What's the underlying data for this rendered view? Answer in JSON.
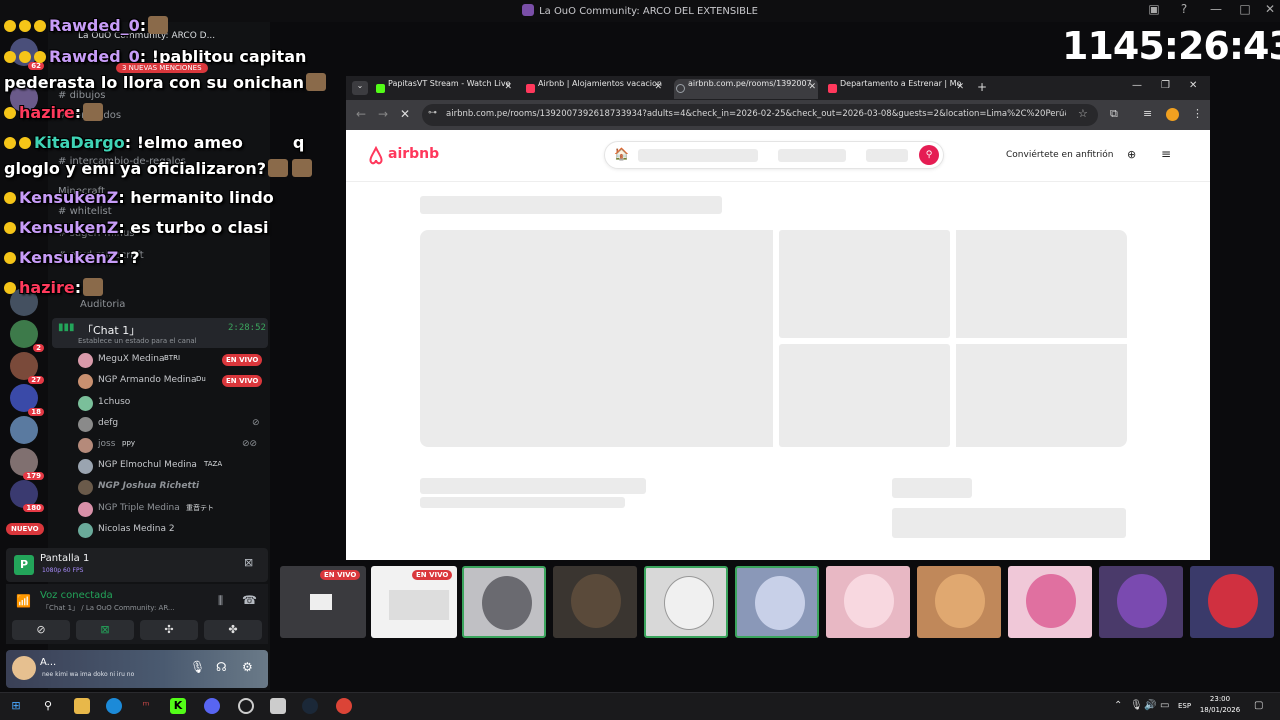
{
  "window": {
    "title": "La OuO Community: ARCO DEL EXTENSIBLE",
    "controls": [
      "—",
      "□",
      "✕"
    ]
  },
  "timer": "1145:26:43",
  "discord": {
    "server_name": "La OuO Community: ARCO D...",
    "mentions_badge": "3 NUEVAS MENCIONES",
    "nuevo_badge": "NUEVO",
    "server_badges": [
      "62",
      "2",
      "27",
      "18",
      "179",
      "180"
    ],
    "channels": [
      "dibujos",
      "comandos",
      "intercambio-de-regalos",
      "Minecraft",
      "whitelist",
      "sugeri-minus",
      "ervd-minecraft",
      "Auditoria"
    ],
    "active_voice": {
      "name": "「Chat 1」",
      "time": "2:28:52",
      "status": "Establece un estado para el canal"
    },
    "voice_members": [
      {
        "name": "MeguX Medina",
        "tag": "BTRI",
        "live": "EN VIVO"
      },
      {
        "name": "NGP Armando Medina",
        "tag": "Du",
        "live": "EN VIVO"
      },
      {
        "name": "1chuso",
        "tag": "",
        "live": ""
      },
      {
        "name": "defg",
        "tag": "",
        "live": ""
      },
      {
        "name": "joss",
        "tag": "ppy",
        "live": ""
      },
      {
        "name": "NGP Elmochul Medina",
        "tag": "TAZA",
        "live": ""
      },
      {
        "name": "NGP Joshua Richetti",
        "tag": "",
        "live": ""
      },
      {
        "name": "NGP Triple Medina",
        "tag": "重音テト",
        "live": ""
      },
      {
        "name": "Nicolas Medina 2",
        "tag": "",
        "live": ""
      }
    ],
    "screen_share": {
      "title": "Pantalla 1",
      "sub": "1080p 60 FPS"
    },
    "voice": {
      "title": "Voz conectada",
      "sub": "「Chat 1」 / La OuO Community: AR..."
    },
    "user": {
      "name": "A...",
      "status": "nee kimi wa ima doko ni iru no"
    }
  },
  "chat": [
    {
      "user": "Rawded_0",
      "msg": ":",
      "cls": "u1"
    },
    {
      "user": "Rawded_0",
      "msg": ": !pablitou capitan",
      "cls": "u1"
    },
    {
      "user": "",
      "msg": "pederasta lo llora con su onichan",
      "cls": "u1"
    },
    {
      "user": "hazire",
      "msg": ":",
      "cls": "u3"
    },
    {
      "user": "KitaDargo",
      "msg": ": !elmo ameo",
      "cls": "u2"
    },
    {
      "user": "",
      "msg": "gloglo y emi ya oficializaron?",
      "cls": "u1"
    },
    {
      "user": "KensukenZ",
      "msg": ": hermanito lindo",
      "cls": "u1"
    },
    {
      "user": "KensukenZ",
      "msg": ": es turbo o clasi",
      "cls": "u1"
    },
    {
      "user": "KensukenZ",
      "msg": ": ?",
      "cls": "u1"
    },
    {
      "user": "hazire",
      "msg": ":",
      "cls": "u3"
    }
  ],
  "chat_extra": {
    "q": "q"
  },
  "browser": {
    "tabs": [
      {
        "label": "PapitasVT Stream - Watch Live",
        "color": "#53fc18",
        "close": "✕"
      },
      {
        "label": "Airbnb | Alojamientos vacacion",
        "color": "#ff385c",
        "close": "✕"
      },
      {
        "label": "airbnb.com.pe/rooms/1392007",
        "color": "#9aa0a6",
        "close": "✕"
      },
      {
        "label": "Departamento a Estrenar | Mo",
        "color": "#ff385c",
        "close": "✕"
      }
    ],
    "new_tab": "+",
    "url": "airbnb.com.pe/rooms/1392007392618733934?adults=4&check_in=2026-02-25&check_out=2026-03-08&guests=2&location=Lima%2C%20Perú&search_mod..."
  },
  "airbnb": {
    "logo": "airbnb",
    "host_link": "Conviértete en anfitrión",
    "brand_color": "#ff385c"
  },
  "filmstrip": {
    "live_labels": [
      "EN VIVO",
      "EN VIVO"
    ]
  },
  "taskbar": {
    "time": "23:00",
    "date": "18/01/2026",
    "lang": "ESP"
  }
}
